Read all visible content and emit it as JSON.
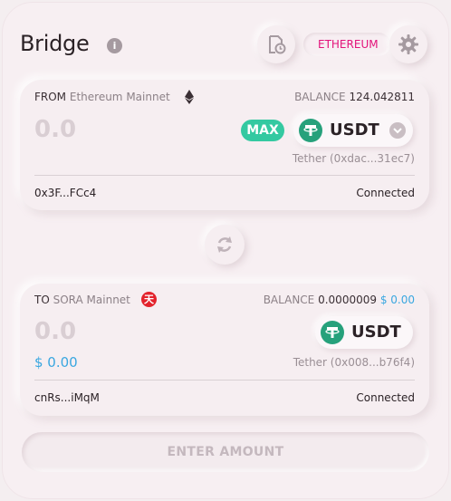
{
  "header": {
    "title": "Bridge",
    "info_glyph": "i",
    "network_label": "ETHEREUM"
  },
  "from": {
    "label": "FROM",
    "network": "Ethereum Mainnet",
    "balance_label": "BALANCE",
    "balance_value": "124.042811",
    "amount": "0.0",
    "max_label": "MAX",
    "token_symbol": "USDT",
    "token_desc": "Tether (0xdac...31ec7)",
    "address": "0x3F...FCc4",
    "status": "Connected"
  },
  "to": {
    "label": "TO",
    "network": "SORA Mainnet",
    "network_badge": "天",
    "balance_label": "BALANCE",
    "balance_value": "0.0000009",
    "balance_usd": "$ 0.00",
    "amount": "0.0",
    "usd_amount": "$ 0.00",
    "token_symbol": "USDT",
    "token_desc": "Tether (0x008...b76f4)",
    "address": "cnRs...iMqM",
    "status": "Connected"
  },
  "action": {
    "label": "ENTER AMOUNT"
  },
  "icons": {
    "info": "info-icon",
    "history": "history-icon",
    "settings": "gear-icon",
    "ethereum": "ethereum-icon",
    "sora": "sora-icon",
    "tether": "tether-icon",
    "swap": "swap-icon",
    "chevron": "chevron-down-icon"
  },
  "colors": {
    "accent": "#e3127a",
    "max": "#34c9a1",
    "tether": "#26a17b",
    "usd": "#3aa7e0",
    "sora": "#e3232c"
  }
}
